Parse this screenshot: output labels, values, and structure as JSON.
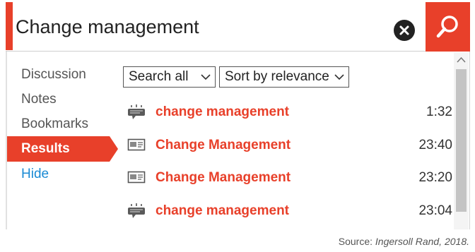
{
  "search": {
    "query": "Change management"
  },
  "icons": {
    "clear": "clear-x-icon",
    "search": "magnifier-icon",
    "spoken": "speech-transcript-icon",
    "slide": "slide-icon",
    "chevron": "chevron-down-icon",
    "scroll_up": "caret-up-icon"
  },
  "sidebar": {
    "items": [
      {
        "label": "Discussion"
      },
      {
        "label": "Notes"
      },
      {
        "label": "Bookmarks"
      },
      {
        "label": "Results",
        "active": true
      },
      {
        "label": "Hide",
        "link": true
      }
    ]
  },
  "filters": {
    "scope": "Search all",
    "sort": "Sort by relevance"
  },
  "results": [
    {
      "type": "spoken",
      "title": "change management",
      "time": "1:32"
    },
    {
      "type": "slide",
      "title": "Change Management",
      "time": "23:40"
    },
    {
      "type": "slide",
      "title": "Change Management",
      "time": "23:20"
    },
    {
      "type": "spoken",
      "title": "change management",
      "time": "23:04"
    }
  ],
  "source": {
    "prefix": "Source: ",
    "citation": "Ingersoll Rand, 2018."
  },
  "colors": {
    "accent": "#e8402a",
    "link": "#1a8ad4"
  }
}
